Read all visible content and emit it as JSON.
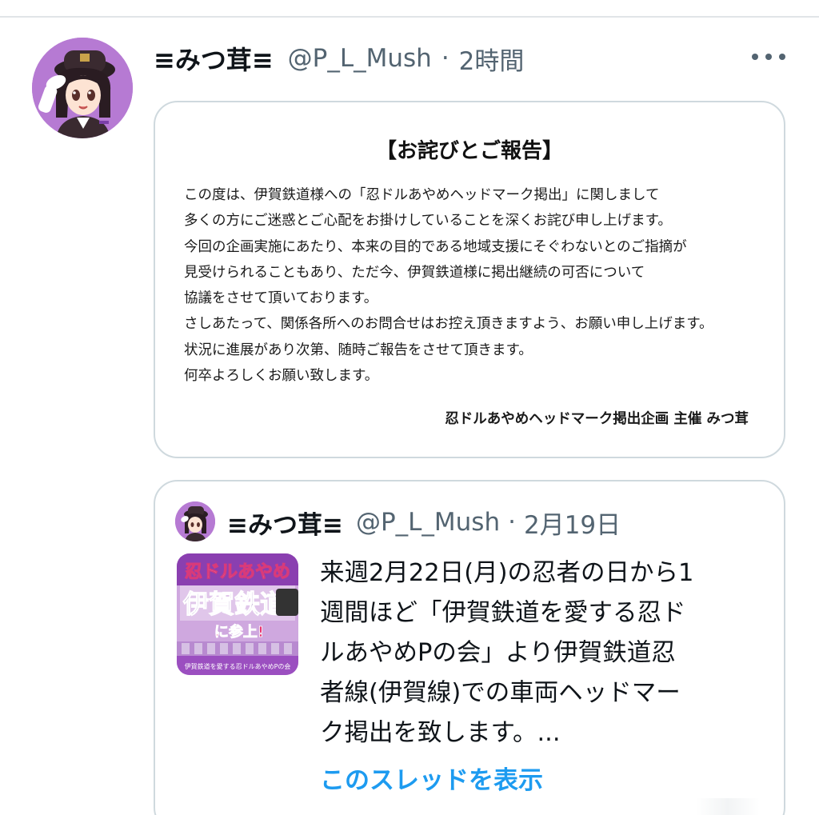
{
  "tweet": {
    "display_name": "≡みつ茸≡",
    "handle": "@P_L_Mush",
    "separator": "·",
    "time": "2時間",
    "avatar_icon": "user-avatar-ninja-girl",
    "more_icon": "more-horizontal-icon"
  },
  "notice_image": {
    "title": "【お詫びとご報告】",
    "lines": [
      "この度は、伊賀鉄道様への「忍ドルあやめヘッドマーク掲出」に関しまして",
      "多くの方にご迷惑とご心配をお掛けしていることを深くお詫び申し上げます。",
      "今回の企画実施にあたり、本来の目的である地域支援にそぐわないとのご指摘が",
      "見受けられることもあり、ただ今、伊賀鉄道様に掲出継続の可否について",
      "協議をさせて頂いております。",
      "さしあたって、関係各所へのお問合せはお控え頂きますよう、お願い申し上げます。",
      "状況に進展があり次第、随時ご報告をさせて頂きます。",
      "何卒よろしくお願い致します。"
    ],
    "signature": "忍ドルあやめヘッドマーク掲出企画 主催 みつ茸"
  },
  "quoted_tweet": {
    "display_name": "≡みつ茸≡",
    "handle": "@P_L_Mush",
    "separator": "·",
    "time": "2月19日",
    "thumbnail_text": {
      "line1": "忍ドルあやめ",
      "line2": "伊賀鉄道",
      "line3": "に参上!",
      "caption": "伊賀鉄道を愛する忍ドルあやめPの会"
    },
    "text_lines": [
      "来週2月22日(月)の忍者の日から1",
      "週間ほど「伊賀鉄道を愛する忍ド",
      "ルあやめPの会」より伊賀鉄道忍",
      "者線(伊賀線)での車両ヘッドマー",
      "ク掲出を致します。..."
    ],
    "show_thread_label": "このスレッドを表示"
  },
  "colors": {
    "text_primary": "#0f1419",
    "text_secondary": "#536471",
    "link": "#1d9bf0",
    "border": "#cfd9de",
    "avatar_bg": "#b67ad3"
  }
}
